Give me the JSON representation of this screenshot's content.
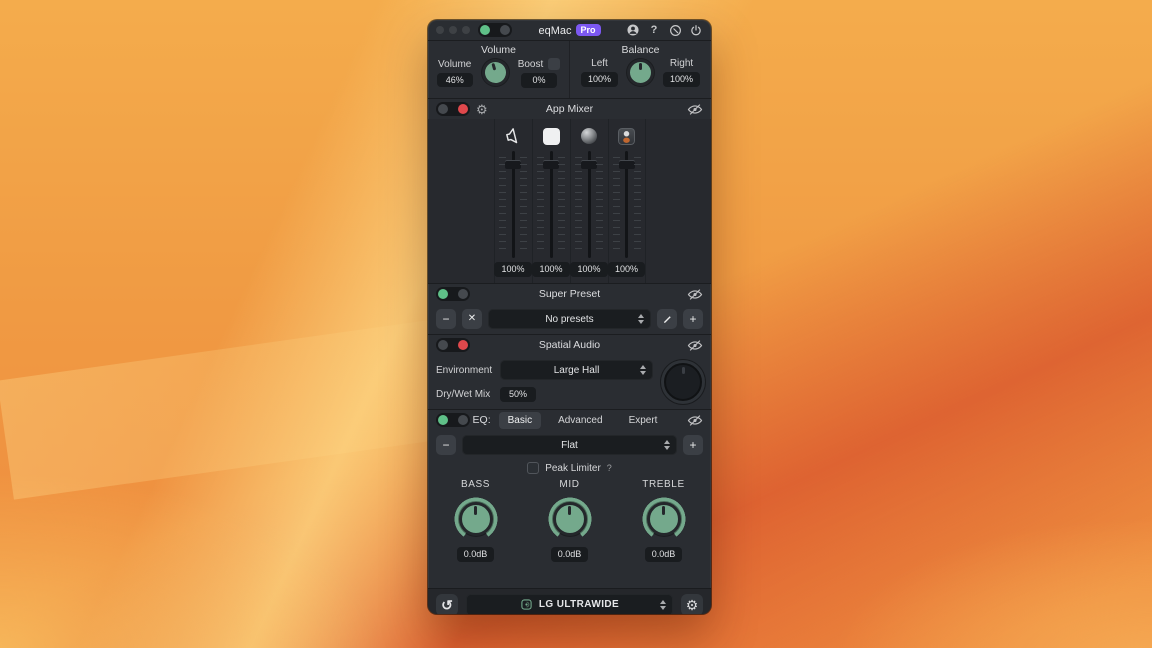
{
  "colors": {
    "accent_green": "#74a98c",
    "toggle_green": "#5fc088",
    "toggle_red": "#e0484c",
    "pro_badge_purple": "#7c58f2",
    "window_bg": "#2a2d32",
    "wallpaper_orange": "#f09a43"
  },
  "titlebar": {
    "title": "eqMac",
    "pro_badge": "Pro"
  },
  "volume": {
    "heading": "Volume",
    "knob_label": "Volume",
    "knob_value": "46%",
    "boost_label": "Boost",
    "boost_value": "0%"
  },
  "balance": {
    "heading": "Balance",
    "left_label": "Left",
    "left_value": "100%",
    "right_label": "Right",
    "right_value": "100%"
  },
  "app_mixer": {
    "heading": "App Mixer",
    "channels": [
      {
        "icon": "speaker-app-icon",
        "value": "100%"
      },
      {
        "icon": "white-app-icon",
        "value": "100%"
      },
      {
        "icon": "sphere-app-icon",
        "value": "100%"
      },
      {
        "icon": "boxy-app-icon",
        "value": "100%"
      }
    ]
  },
  "super_preset": {
    "heading": "Super Preset",
    "dropdown_value": "No presets"
  },
  "spatial_audio": {
    "heading": "Spatial Audio",
    "environment_label": "Environment",
    "environment_value": "Large Hall",
    "dry_wet_label": "Dry/Wet Mix",
    "dry_wet_value": "50%"
  },
  "eq": {
    "heading": "EQ:",
    "tabs": [
      {
        "label": "Basic",
        "active": true
      },
      {
        "label": "Advanced",
        "active": false
      },
      {
        "label": "Expert",
        "active": false
      }
    ],
    "preset_value": "Flat",
    "peak_limiter_label": "Peak Limiter",
    "peak_limiter_help": "?",
    "bands": [
      {
        "label": "BASS",
        "value": "0.0dB"
      },
      {
        "label": "MID",
        "value": "0.0dB"
      },
      {
        "label": "TREBLE",
        "value": "0.0dB"
      }
    ]
  },
  "footer": {
    "device_value": "LG ULTRAWIDE"
  },
  "glyphs": {
    "minus": "−",
    "close": "✕",
    "plus": "+",
    "gear": "⚙",
    "reset": "↺",
    "help": "?"
  }
}
